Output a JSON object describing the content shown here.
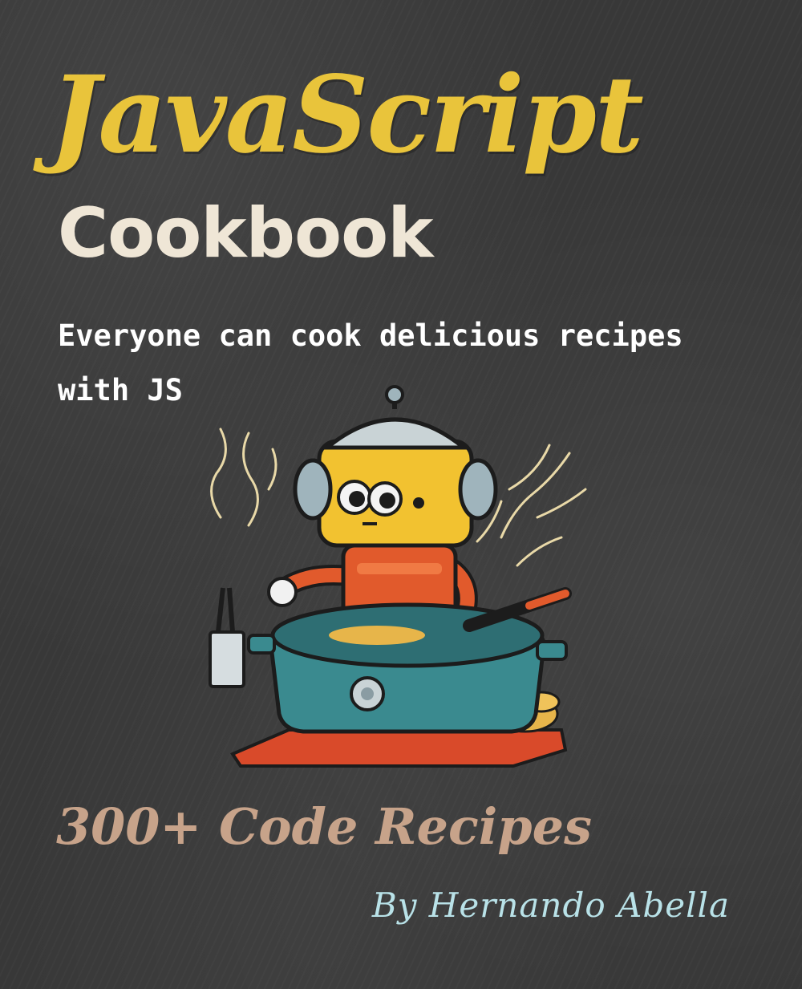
{
  "cover": {
    "title": "JavaScript",
    "subtitle": "Cookbook",
    "tagline": "Everyone can cook delicious recipes with JS",
    "badge": "300+ Code Recipes",
    "author": "By Hernando Abella"
  },
  "illustration": {
    "description_icon": "robot-chef-cooking-pot-icon"
  },
  "colors": {
    "background": "#383838",
    "title": "#e9c43b",
    "subtitle": "#efe6d6",
    "tagline": "#ffffff",
    "badge": "#c7a38a",
    "author": "#b9e2e8"
  }
}
